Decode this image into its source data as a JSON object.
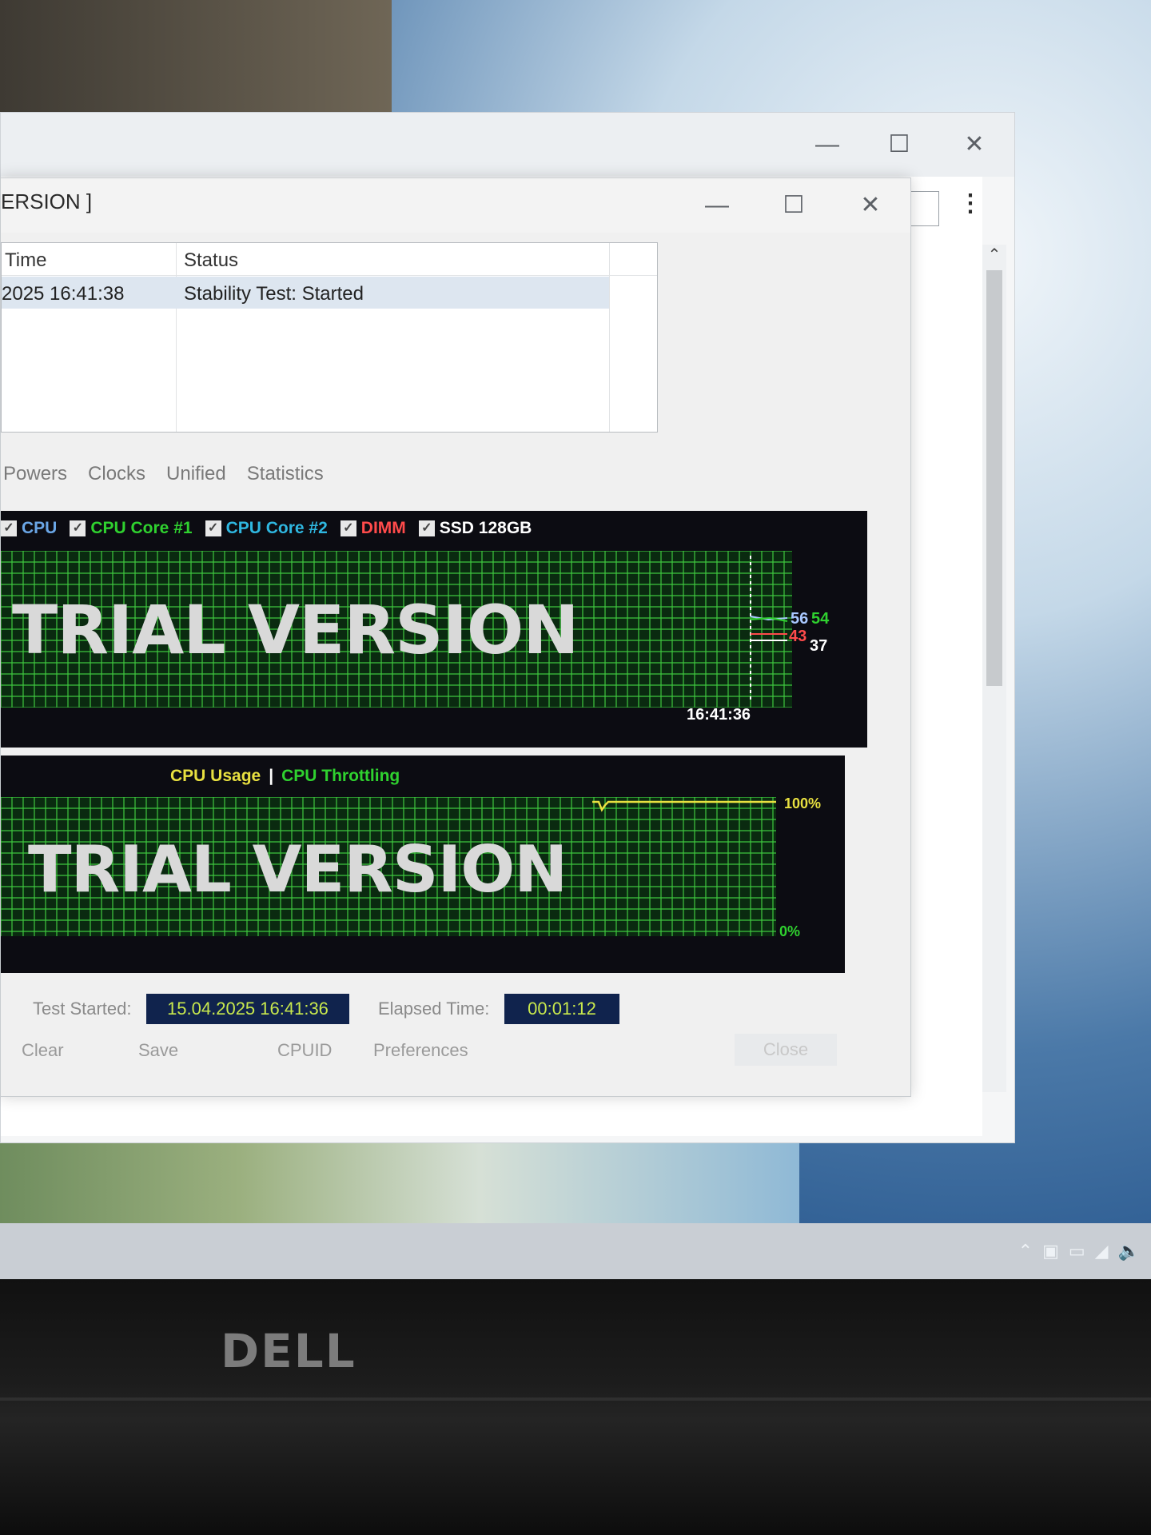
{
  "window": {
    "title": "ERSION ]",
    "minimize": "—",
    "maximize": "☐",
    "close": "✕"
  },
  "back_window": {
    "menu": "⋮",
    "scroll_up": "⌃"
  },
  "log": {
    "columns": [
      "Time",
      "Status"
    ],
    "rows": [
      {
        "time": "2025 16:41:38",
        "status": "Stability Test: Started"
      }
    ]
  },
  "tabs": [
    "Powers",
    "Clocks",
    "Unified",
    "Statistics"
  ],
  "temperature_chart": {
    "legend": [
      {
        "label": "CPU",
        "color": "#6aa6e6"
      },
      {
        "label": "CPU Core #1",
        "color": "#2fd12f"
      },
      {
        "label": "CPU Core #2",
        "color": "#2fb7e0"
      },
      {
        "label": "DIMM",
        "color": "#ff4b4b"
      },
      {
        "label": "SSD 128GB",
        "color": "#ffffff"
      }
    ],
    "watermark": "TRIAL VERSION",
    "time_label": "16:41:36",
    "readouts": [
      {
        "value": "56",
        "color": "#a9c8ff"
      },
      {
        "value": "54",
        "color": "#2fd12f"
      },
      {
        "value": "43",
        "color": "#ff4b4b"
      },
      {
        "value": "37",
        "color": "#ffffff"
      }
    ]
  },
  "usage_chart": {
    "legend_usage": "CPU Usage",
    "legend_sep": "|",
    "legend_throttling": "CPU Throttling",
    "watermark": "TRIAL VERSION",
    "max_label": "100%",
    "min_label": "0%"
  },
  "status": {
    "test_started_label": "Test Started:",
    "test_started_value": "15.04.2025 16:41:36",
    "elapsed_label": "Elapsed Time:",
    "elapsed_value": "00:01:12"
  },
  "buttons": {
    "clear": "Clear",
    "save": "Save",
    "cpuid": "CPUID",
    "preferences": "Preferences",
    "close": "Close"
  },
  "laptop": {
    "logo": "DELL"
  },
  "tray_icons": [
    "chevron-up-icon",
    "network-icon",
    "battery-icon",
    "wifi-icon",
    "volume-icon"
  ]
}
